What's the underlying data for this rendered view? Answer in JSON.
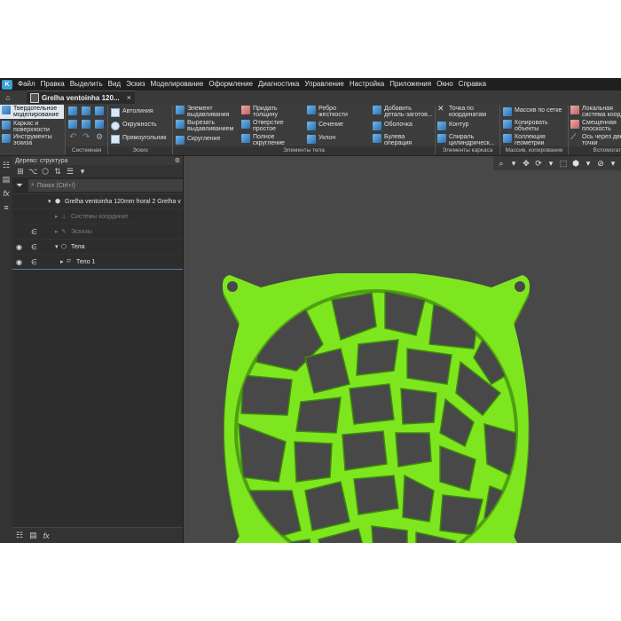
{
  "menu": [
    "Файл",
    "Правка",
    "Выделить",
    "Вид",
    "Эскиз",
    "Моделирование",
    "Оформление",
    "Диагностика",
    "Управление",
    "Настройка",
    "Приложения",
    "Окно",
    "Справка"
  ],
  "tab": {
    "title": "Grelha ventoinha 120...",
    "close": "×"
  },
  "ribbon": {
    "modes": [
      {
        "label": "Твердотельное моделирование"
      },
      {
        "label": "Каркас и поверхности"
      },
      {
        "label": "Инструменты эскиза"
      }
    ],
    "groups": [
      "Системная",
      "Эскиз",
      "Элементы тела",
      "Элементы каркаса",
      "Массив, копирование",
      "Вспомогат"
    ],
    "sketch": [
      "Автолиния",
      "Окружность",
      "Прямоугольник"
    ],
    "body": [
      "Элемент выдавливания",
      "Вырезать выдавливанием",
      "Скругление",
      "Придать толщину",
      "Отверстие простое",
      "Полное скругление",
      "Ребро жесткости",
      "Сечение",
      "Уклон",
      "Добавить деталь-заготов...",
      "Оболочка",
      "Булева операция"
    ],
    "wire": [
      "Точка по координатам",
      "Контур",
      "Спираль цилиндрическ..."
    ],
    "array": [
      "Массив по сетке",
      "Копировать объекты",
      "Коллекция геометрии"
    ],
    "aux": [
      "Локальная система коорд",
      "Смещенная плоскость",
      "Ось через две точки"
    ]
  },
  "tree": {
    "header": "Дерево: структура",
    "search_placeholder": "Поиск (Ctrl+/)",
    "root": "Grelha ventoinha 120mm froral 2 Grelha v",
    "coord": "Системы координат",
    "sketches": "Эскизы",
    "bodies": "Тела",
    "body1": "Тело 1"
  },
  "colors": {
    "part": "#7ee61e",
    "part_dark": "#4fa012",
    "viewport": "#484848"
  },
  "icons": [
    "home-icon",
    "document-icon",
    "filter-icon",
    "eye-icon",
    "gear-icon",
    "tree-icon",
    "fx-icon"
  ]
}
